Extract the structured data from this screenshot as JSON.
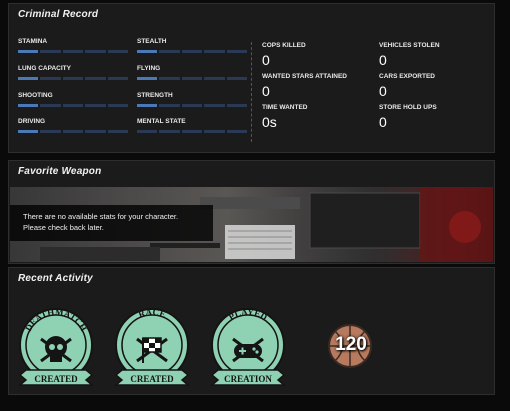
{
  "criminal_record": {
    "title": "Criminal Record",
    "skills": [
      {
        "label": "STAMINA",
        "level": 0.1
      },
      {
        "label": "STEALTH",
        "level": 0.1
      },
      {
        "label": "LUNG CAPACITY",
        "level": 0.1
      },
      {
        "label": "FLYING",
        "level": 0.1
      },
      {
        "label": "SHOOTING",
        "level": 0.1
      },
      {
        "label": "STRENGTH",
        "level": 0.1
      },
      {
        "label": "DRIVING",
        "level": 0.1
      },
      {
        "label": "MENTAL STATE",
        "level": 0.0
      }
    ],
    "stats": [
      {
        "label": "COPS KILLED",
        "value": "0"
      },
      {
        "label": "VEHICLES STOLEN",
        "value": "0"
      },
      {
        "label": "WANTED STARS ATTAINED",
        "value": "0"
      },
      {
        "label": "CARS EXPORTED",
        "value": "0"
      },
      {
        "label": "TIME WANTED",
        "value": "0s"
      },
      {
        "label": "STORE HOLD UPS",
        "value": "0"
      }
    ]
  },
  "favorite_weapon": {
    "title": "Favorite Weapon",
    "message_line1": "There are no available stats for your character.",
    "message_line2": "Please check back later."
  },
  "recent_activity": {
    "title": "Recent Activity",
    "badges": [
      {
        "top_text": "DEATHMATCH",
        "bottom_text": "CREATED",
        "icon": "skull-icon"
      },
      {
        "top_text": "RACE",
        "bottom_text": "CREATED",
        "icon": "checkered-flag-icon"
      },
      {
        "top_text": "PLAYED",
        "bottom_text": "CREATION",
        "icon": "gamepad-icon"
      }
    ],
    "basketball_count": "120"
  },
  "colors": {
    "skill_fill": "#4a79b8",
    "badge_green": "#8fd1b3",
    "badge_dark": "#141414"
  }
}
